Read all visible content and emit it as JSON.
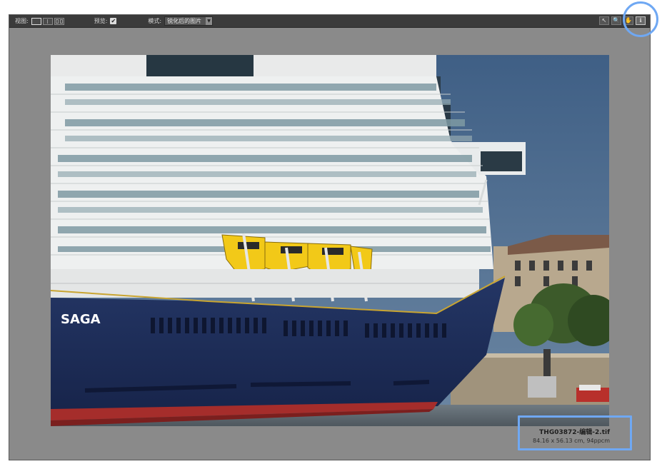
{
  "toolbar": {
    "view_label": "视图:",
    "preview_label": "预览:",
    "preview_checked": "✔",
    "mode_label": "模式:",
    "mode_value": "锐化后的图片",
    "tools": {
      "pointer": "↖",
      "zoom": "🔍",
      "hand": "✋",
      "info": "ℹ"
    }
  },
  "image": {
    "hull_text": "SAGA"
  },
  "file_info": {
    "name": "THG03872-编辑-2.tif",
    "dimensions": "84.16 x 56.13 cm, 94ppcm"
  },
  "colors": {
    "accent": "#6fa8f3",
    "hull": "#1d2d57",
    "sky": "#4a6b90",
    "lifeboat": "#f2c918"
  }
}
